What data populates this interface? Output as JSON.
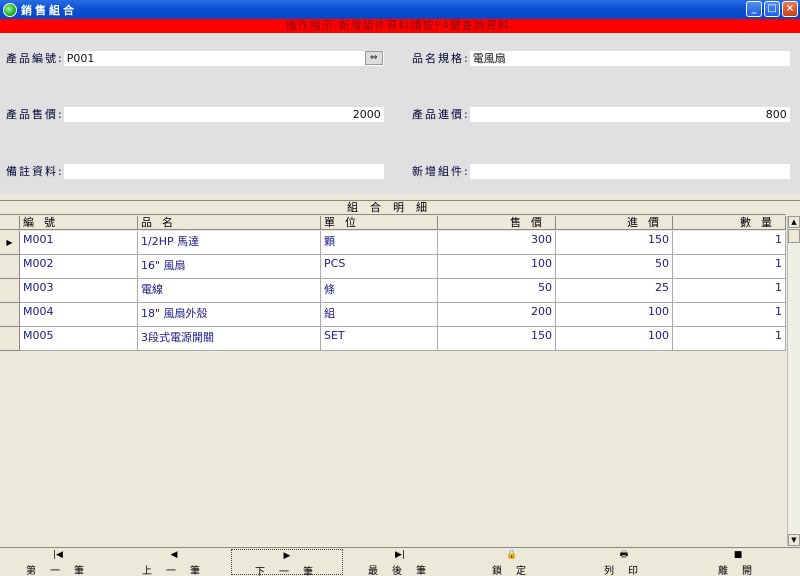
{
  "window": {
    "title": "銷售組合",
    "controls": [
      "_",
      "□",
      "×"
    ]
  },
  "hint": "操作指示:新增組件資料請按F4鍵查詢資料.",
  "form": {
    "product_code": {
      "label": "產品編號:",
      "value": "P001"
    },
    "product_spec": {
      "label": "品名規格:",
      "value": "電風扇"
    },
    "sale_price": {
      "label": "產品售價:",
      "value": "2000"
    },
    "cost_price": {
      "label": "產品進價:",
      "value": "800"
    },
    "remark": {
      "label": "備註資料:",
      "value": ""
    },
    "new_component": {
      "label": "新增組件:",
      "value": ""
    }
  },
  "grid": {
    "caption": "組合明細",
    "columns": [
      "編號",
      "品名",
      "單位",
      "售價",
      "進價",
      "數量"
    ],
    "rows": [
      [
        "M001",
        "1/2HP 馬達",
        "顆",
        "300",
        "150",
        "1"
      ],
      [
        "M002",
        "16\" 風扇",
        "PCS",
        "100",
        "50",
        "1"
      ],
      [
        "M003",
        "電線",
        "條",
        "50",
        "25",
        "1"
      ],
      [
        "M004",
        "18\" 風扇外殼",
        "組",
        "200",
        "100",
        "1"
      ],
      [
        "M005",
        "3段式電源開關",
        "SET",
        "150",
        "100",
        "1"
      ]
    ]
  },
  "toolbar": {
    "first": {
      "icon": "first-record-icon",
      "label": "第一筆",
      "glyph": "|◀"
    },
    "prev": {
      "icon": "prev-record-icon",
      "label": "上一筆",
      "glyph": "◀"
    },
    "next": {
      "icon": "next-record-icon",
      "label": "下一筆",
      "glyph": "▶"
    },
    "last": {
      "icon": "last-record-icon",
      "label": "最後筆",
      "glyph": "▶|"
    },
    "lock": {
      "icon": "lock-icon",
      "label": "鎖定",
      "glyph": "🔒"
    },
    "print": {
      "icon": "printer-icon",
      "label": "列印",
      "glyph": "🖶"
    },
    "exit": {
      "icon": "exit-icon",
      "label": "離開",
      "glyph": "■"
    }
  }
}
